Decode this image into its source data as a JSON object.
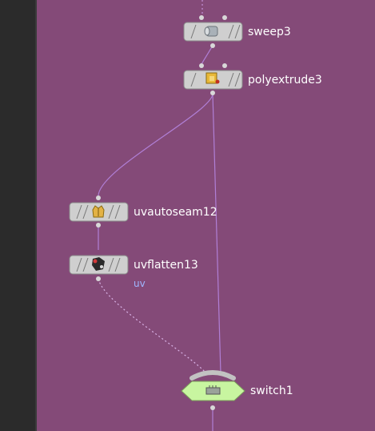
{
  "network": {
    "nodes": [
      {
        "id": "sweep3",
        "label": "sweep3",
        "icon": "sweep-icon"
      },
      {
        "id": "polyextrude3",
        "label": "polyextrude3",
        "icon": "polyextrude-icon"
      },
      {
        "id": "uvautoseam12",
        "label": "uvautoseam12",
        "icon": "uvautoseam-icon"
      },
      {
        "id": "uvflatten13",
        "label": "uvflatten13",
        "icon": "uvflatten-icon",
        "flag": "uv"
      },
      {
        "id": "switch1",
        "label": "switch1",
        "icon": "switch-icon"
      }
    ],
    "colors": {
      "background": "#844a78",
      "left_panel": "#2b2b2b",
      "node_body": "#cfcfcf",
      "switch_body": "#c8f5a0",
      "wire": "#b07fd6",
      "label": "#ffffff",
      "flag_text": "#9fb7ff"
    }
  }
}
